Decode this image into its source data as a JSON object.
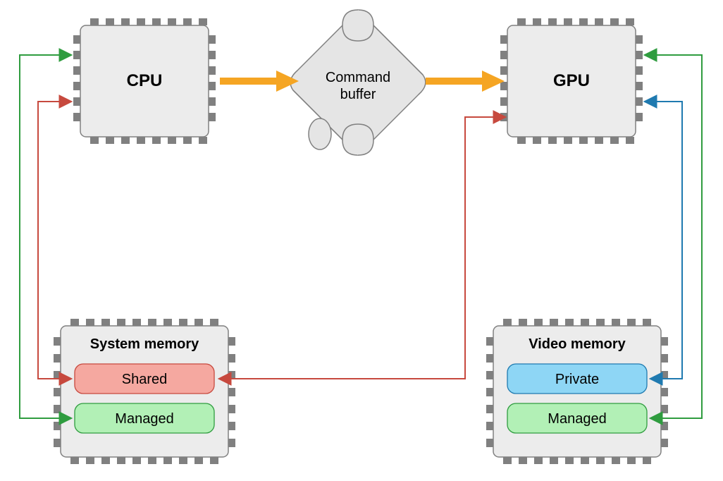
{
  "nodes": {
    "cpu": {
      "label": "CPU"
    },
    "gpu": {
      "label": "GPU"
    },
    "command_buffer": {
      "line1": "Command",
      "line2": "buffer"
    },
    "system_memory": {
      "title": "System memory",
      "slots": {
        "shared": "Shared",
        "managed": "Managed"
      }
    },
    "video_memory": {
      "title": "Video memory",
      "slots": {
        "private": "Private",
        "managed": "Managed"
      }
    }
  },
  "edges": [
    {
      "from": "cpu",
      "to": "command_buffer",
      "color": "orange",
      "bidirectional": false
    },
    {
      "from": "command_buffer",
      "to": "gpu",
      "color": "orange",
      "bidirectional": false
    },
    {
      "from": "cpu",
      "to": "system_memory.shared",
      "color": "red",
      "bidirectional": true
    },
    {
      "from": "gpu",
      "to": "system_memory.shared",
      "color": "red",
      "bidirectional": true
    },
    {
      "from": "cpu",
      "to": "system_memory.managed",
      "color": "green",
      "bidirectional": true
    },
    {
      "from": "gpu",
      "to": "video_memory.managed",
      "color": "green",
      "bidirectional": true
    },
    {
      "from": "gpu",
      "to": "video_memory.private",
      "color": "blue",
      "bidirectional": true
    }
  ],
  "colors": {
    "orange": "#f5a523",
    "red": "#c7493e",
    "green": "#2f9c3f",
    "blue": "#1f7ab0",
    "box_fill": "#ececec",
    "box_stroke": "#808080",
    "shared_fill": "#f5a8a0",
    "private_fill": "#8ed6f5",
    "managed_fill": "#b2f0b6"
  }
}
